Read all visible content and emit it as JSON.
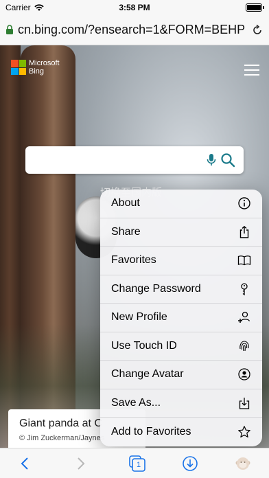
{
  "status_bar": {
    "carrier": "Carrier",
    "time": "3:58 PM"
  },
  "address_bar": {
    "url": "cn.bing.com/?ensearch=1&FORM=BEHP"
  },
  "page": {
    "logo_line1": "Microsoft",
    "logo_line2": "Bing",
    "switch_text": "切换至国内版",
    "caption_title": "Giant panda at C",
    "caption_credit": "© Jim Zuckerman/Jaynes"
  },
  "menu": {
    "items": [
      {
        "label": "About",
        "icon": "info-icon"
      },
      {
        "label": "Share",
        "icon": "share-icon"
      },
      {
        "label": "Favorites",
        "icon": "book-icon"
      },
      {
        "label": "Change Password",
        "icon": "key-icon"
      },
      {
        "label": "New Profile",
        "icon": "add-person-icon"
      },
      {
        "label": "Use Touch ID",
        "icon": "fingerprint-icon"
      },
      {
        "label": "Change Avatar",
        "icon": "avatar-icon"
      },
      {
        "label": "Save As...",
        "icon": "download-box-icon"
      },
      {
        "label": "Add to Favorites",
        "icon": "star-icon"
      }
    ]
  },
  "toolbar": {
    "tab_count": "1"
  },
  "colors": {
    "accent": "#1a73e8",
    "search_icon": "#1a7a8a"
  }
}
